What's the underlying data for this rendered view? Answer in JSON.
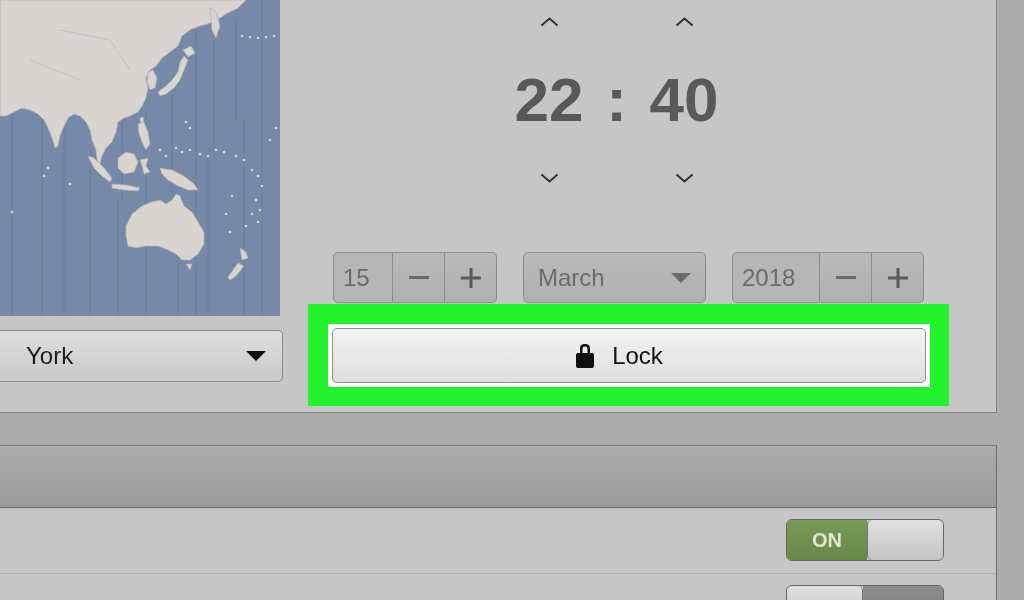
{
  "timezone_select": {
    "value": "York"
  },
  "time": {
    "hours": "22",
    "separator": ":",
    "minutes": "40"
  },
  "date": {
    "day": "15",
    "month": "March",
    "year": "2018",
    "disabled": true
  },
  "lock_button": {
    "label": "Lock",
    "highlighted": true
  },
  "settings_rows": [
    {
      "kind": "switch",
      "on": true,
      "label": "ON"
    },
    {
      "kind": "switch",
      "on": false
    }
  ]
}
